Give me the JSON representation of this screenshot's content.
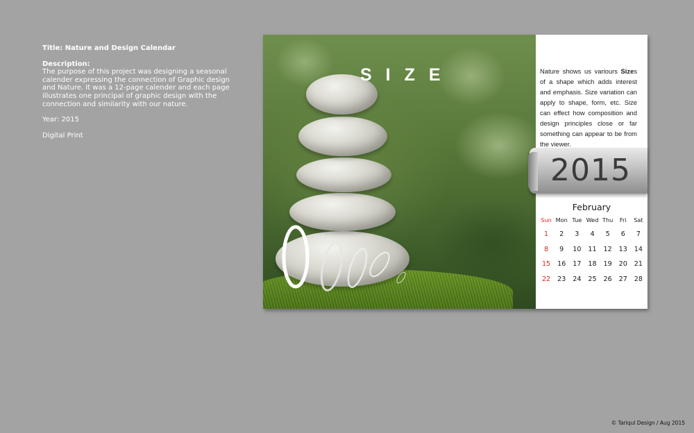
{
  "info": {
    "title": "Title: Nature and Design Calendar",
    "description_label": "Description:",
    "description": "The purpose of this project was designing a seasonal calender expressing the connection of Graphic design and Nature. It was a 12-page calender and each page illustrates one principal of graphic design with the connection and similarity with our nature.",
    "year": "Year: 2015",
    "medium": "Digital Print"
  },
  "calendar": {
    "heading": "SIZE",
    "text_before": "Nature shows us variours ",
    "text_bold": "Size",
    "text_after": "s of a shape which adds interest and emphasis. Size variation can apply to shape, form, etc. Size can effect how composition and design principles close or far something can appear to be from the viewer.",
    "year": "2015",
    "month": "February",
    "day_names": [
      "Sun",
      "Mon",
      "Tue",
      "Wed",
      "Thu",
      "Fri",
      "Sat"
    ],
    "days": [
      "1",
      "2",
      "3",
      "4",
      "5",
      "6",
      "7",
      "8",
      "9",
      "10",
      "11",
      "12",
      "13",
      "14",
      "15",
      "16",
      "17",
      "18",
      "19",
      "20",
      "21",
      "22",
      "23",
      "24",
      "25",
      "26",
      "27",
      "28"
    ],
    "sunday_color": "#d9251d"
  },
  "copyright": "© Tariqul Design / Aug 2015"
}
